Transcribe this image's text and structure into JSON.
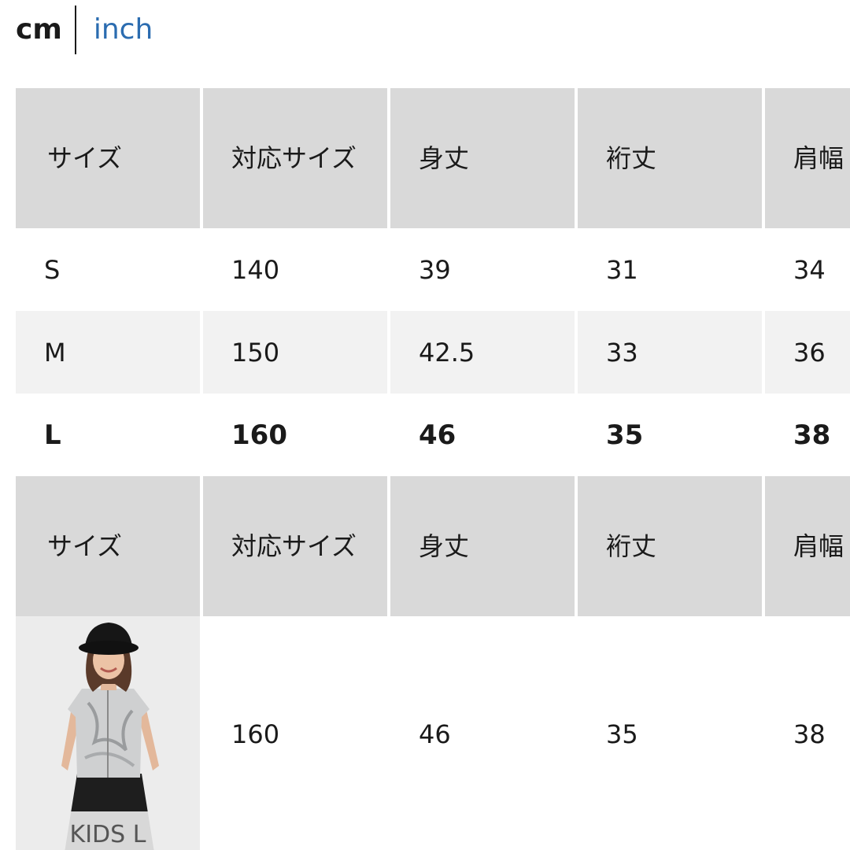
{
  "units": {
    "cm_label": "cm",
    "inch_label": "inch",
    "selected": "cm",
    "inch_color": "#2b6cb0"
  },
  "table1": {
    "headers": [
      "サイズ",
      "対応サイズ",
      "身丈",
      "裄丈",
      "肩幅"
    ],
    "rows": [
      {
        "cells": [
          "S",
          "140",
          "39",
          "31",
          "34"
        ]
      },
      {
        "cells": [
          "M",
          "150",
          "42.5",
          "33",
          "36"
        ]
      },
      {
        "cells": [
          "L",
          "160",
          "46",
          "35",
          "38"
        ]
      }
    ]
  },
  "table2": {
    "headers": [
      "サイズ",
      "対応サイズ",
      "身丈",
      "裄丈",
      "肩幅"
    ],
    "rows": [
      {
        "photo_caption": "KIDS L",
        "cells": [
          "160",
          "46",
          "35",
          "38"
        ]
      }
    ]
  },
  "colors": {
    "header_bg": "#d9d9d9",
    "alt_row_bg": "#f2f2f2",
    "text": "#1a1a1a"
  }
}
